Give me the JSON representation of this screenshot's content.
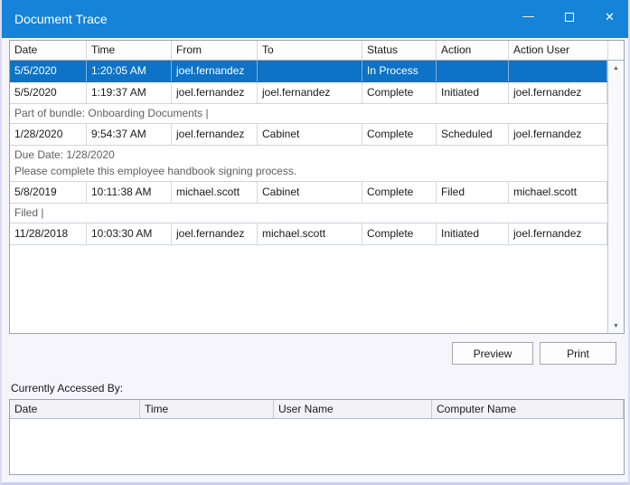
{
  "window": {
    "title": "Document Trace"
  },
  "icons": {
    "minimize": "—",
    "close": "✕",
    "scroll_up": "▲",
    "scroll_down": "▼"
  },
  "colors": {
    "titlebar_blue": "#1583d8",
    "selection_blue": "#0e72c6",
    "grid_line": "#ccd5e2",
    "note_text": "#5f5f5f"
  },
  "trace_table": {
    "columns": [
      "Date",
      "Time",
      "From",
      "To",
      "Status",
      "Action",
      "Action User"
    ],
    "rows": [
      {
        "type": "data",
        "selected": true,
        "cells": [
          "5/5/2020",
          "1:20:05 AM",
          "joel.fernandez",
          "",
          "In Process",
          "",
          ""
        ]
      },
      {
        "type": "data",
        "selected": false,
        "cells": [
          "5/5/2020",
          "1:19:37 AM",
          "joel.fernandez",
          "joel.fernandez",
          "Complete",
          "Initiated",
          "joel.fernandez"
        ]
      },
      {
        "type": "note",
        "lines": [
          "Part of bundle: Onboarding Documents |"
        ]
      },
      {
        "type": "data",
        "selected": false,
        "cells": [
          "1/28/2020",
          "9:54:37 AM",
          "joel.fernandez",
          "Cabinet",
          "Complete",
          "Scheduled",
          "joel.fernandez"
        ]
      },
      {
        "type": "note",
        "lines": [
          "Due Date: 1/28/2020",
          "Please complete this employee handbook signing process."
        ]
      },
      {
        "type": "data",
        "selected": false,
        "cells": [
          "5/8/2019",
          "10:11:38 AM",
          "michael.scott",
          "Cabinet",
          "Complete",
          "Filed",
          "michael.scott"
        ]
      },
      {
        "type": "note",
        "lines": [
          "Filed |"
        ]
      },
      {
        "type": "data",
        "selected": false,
        "cells": [
          "11/28/2018",
          "10:03:30 AM",
          "joel.fernandez",
          "michael.scott",
          "Complete",
          "Initiated",
          "joel.fernandez"
        ]
      }
    ]
  },
  "buttons": {
    "preview": "Preview",
    "print": "Print"
  },
  "accessed_by": {
    "label": "Currently Accessed By:",
    "columns": [
      "Date",
      "Time",
      "User Name",
      "Computer Name"
    ],
    "rows": []
  }
}
